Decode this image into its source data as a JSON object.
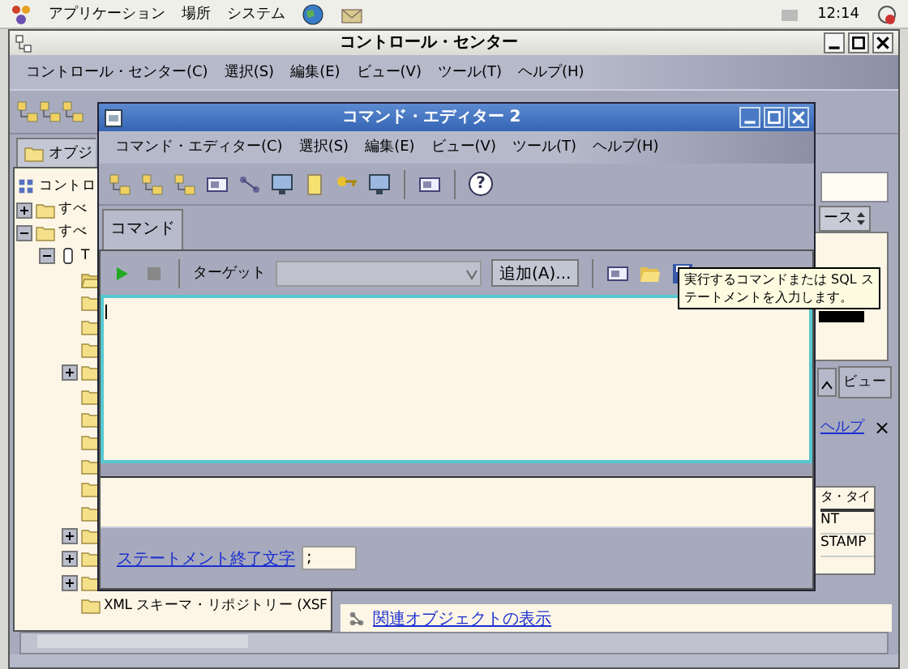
{
  "top_panel": {
    "menus": [
      "アプリケーション",
      "場所",
      "システム"
    ],
    "clock": "12:14"
  },
  "main_window": {
    "title": "コントロール・センター",
    "menus": [
      "コントロール・センター(C)",
      "選択(S)",
      "編集(E)",
      "ビュー(V)",
      "ツール(T)",
      "ヘルプ(H)"
    ],
    "tab": "オブジ",
    "tree": [
      {
        "label": "コントロ",
        "kind": "root",
        "children": [
          {
            "label": "すべ",
            "kind": "folder",
            "expanded": false
          },
          {
            "label": "すべ",
            "kind": "folder",
            "expanded": true,
            "children": [
              {
                "label": "T",
                "kind": "database",
                "expanded": true,
                "children": [
                  {
                    "kind": "folder-open"
                  },
                  {
                    "kind": "folder"
                  },
                  {
                    "kind": "folder"
                  },
                  {
                    "kind": "folder"
                  },
                  {
                    "kind": "folder",
                    "expanded": false
                  },
                  {
                    "kind": "folder"
                  },
                  {
                    "kind": "folder"
                  },
                  {
                    "kind": "folder"
                  },
                  {
                    "kind": "folder"
                  },
                  {
                    "kind": "folder"
                  },
                  {
                    "kind": "folder"
                  },
                  {
                    "kind": "folder",
                    "expanded": false
                  },
                  {
                    "kind": "folder",
                    "expanded": false
                  },
                  {
                    "kind": "folder",
                    "expanded": false
                  },
                  {
                    "label": "XML スキーマ・リポジトリー (XSF",
                    "kind": "folder"
                  }
                ]
              }
            ]
          }
        ]
      }
    ],
    "right_panel": {
      "column_header": "ース",
      "view_button": "ビュー",
      "help_link": "ヘルプ",
      "close": "×",
      "table": {
        "column": "タ・タイ",
        "rows": [
          "NT",
          "STAMP"
        ]
      },
      "related_link": "関連オブジェクトの表示"
    }
  },
  "editor": {
    "title": "コマンド・エディター 2",
    "menus": [
      "コマンド・エディター(C)",
      "選択(S)",
      "編集(E)",
      "ビュー(V)",
      "ツール(T)",
      "ヘルプ(H)"
    ],
    "help_button": "?",
    "tabs": [
      {
        "label": "コマンド",
        "selected": true
      }
    ],
    "target_label": "ターゲット",
    "add_button": "追加(A)...",
    "terminator_link": "ステートメント終了文字",
    "terminator_value": ";"
  },
  "tooltip": {
    "lines": [
      "実行するコマンドまたは SQL ス",
      "テートメントを入力します。"
    ]
  }
}
